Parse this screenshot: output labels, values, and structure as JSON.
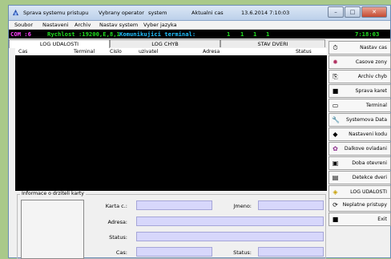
{
  "titlebar": {
    "app_name": "Sprava systemu pristupu",
    "operator_label": "Vybrany operator",
    "operator_value": "system",
    "time_label": "Aktualni cas",
    "datetime": "13.6.2014 7:10:03"
  },
  "menu": [
    "Soubor",
    "Nastaveni",
    "Archiv",
    "Nastav system",
    "Vyber jazyka"
  ],
  "status": {
    "com": "COM :6",
    "speed": "Rychlost :19200,E,8,1",
    "comm_label": "Komunikujici terminal:",
    "terminals": [
      "1",
      "1",
      "1",
      "1"
    ],
    "clock": "7:18:03",
    "colors": {
      "bg": "#000000",
      "com": "#ff40ff",
      "speed": "#20e020",
      "comm": "#20c0ff",
      "terminals": "#20e020",
      "clock": "#20e020"
    }
  },
  "tabs": [
    "LOG UDALOSTI",
    "LOG CHYB",
    "STAV DVERI"
  ],
  "columns": [
    "Cas",
    "Terminal",
    "Cislo",
    "uzivatel",
    "Adresa",
    "Status"
  ],
  "side_buttons": [
    {
      "label": "Nastav cas",
      "icon": "clock-icon"
    },
    {
      "label": "Casove zony",
      "icon": "zones-icon"
    },
    {
      "label": "Archiv chyb",
      "icon": "archive-icon"
    },
    {
      "label": "Sprava karet",
      "icon": "card-icon"
    },
    {
      "label": "Terminal",
      "icon": "terminal-icon"
    },
    {
      "label": "Systemova Data",
      "icon": "wrench-icon"
    },
    {
      "label": "Nastaveni kodu",
      "icon": "code-icon"
    },
    {
      "label": "Dalkove ovladani",
      "icon": "remote-icon"
    },
    {
      "label": "Doba otevreni",
      "icon": "timer-icon"
    },
    {
      "label": "Detekce dveri",
      "icon": "door-icon"
    },
    {
      "label": "LOG UDALOSTI",
      "icon": "log-icon"
    }
  ],
  "bottom_buttons": [
    {
      "label": "Neplatne pristupy",
      "icon": "invalid-access-icon"
    },
    {
      "label": "Exit",
      "icon": "exit-icon"
    }
  ],
  "info": {
    "legend": "Informace o drziteli karty",
    "card_label": "Karta c.:",
    "name_label": "Jmeno:",
    "address_label": "Adresa:",
    "status_label": "Status:",
    "time_label": "Cas:",
    "status2_label": "Status:",
    "field_color": "#d7d7fb"
  }
}
